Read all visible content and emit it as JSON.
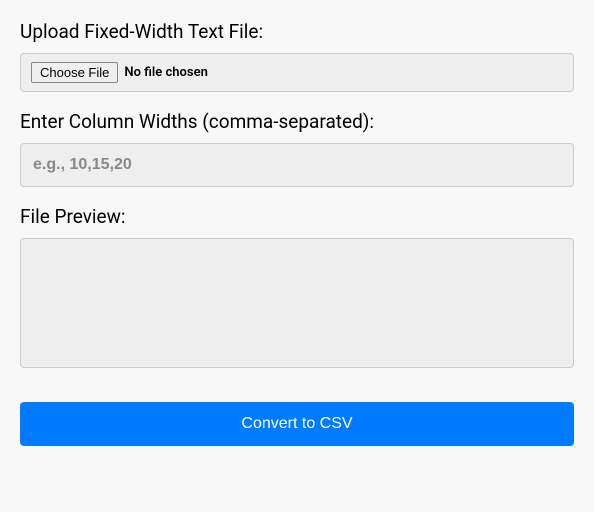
{
  "upload": {
    "label": "Upload Fixed-Width Text File:",
    "choose_button": "Choose File",
    "status": "No file chosen"
  },
  "widths": {
    "label": "Enter Column Widths (comma-separated):",
    "placeholder": "e.g., 10,15,20",
    "value": ""
  },
  "preview": {
    "label": "File Preview:",
    "value": ""
  },
  "convert": {
    "label": "Convert to CSV"
  }
}
